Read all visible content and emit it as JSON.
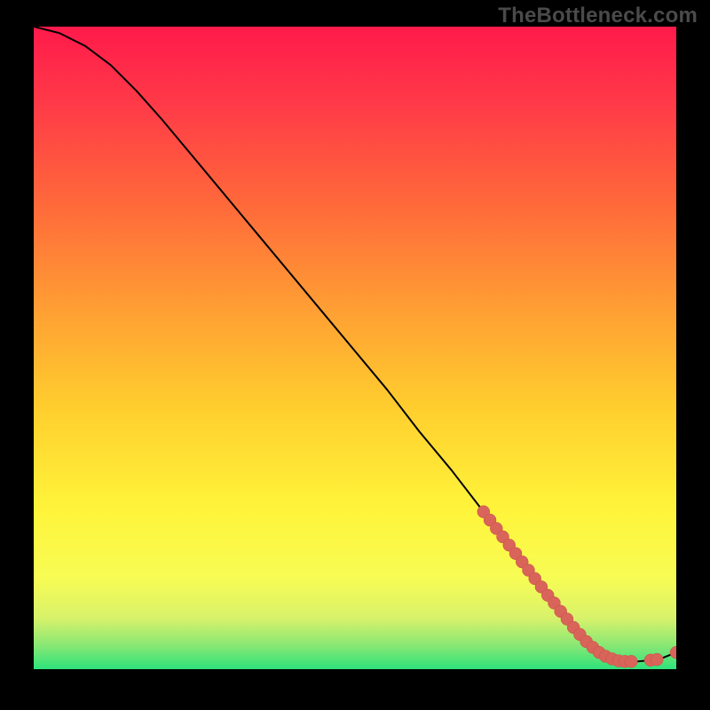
{
  "watermark": "TheBottleneck.com",
  "colors": {
    "gradient_top": "#ff1a4b",
    "gradient_mid_upper": "#ff6a3a",
    "gradient_mid": "#ffd02e",
    "gradient_mid_lower": "#fff43a",
    "gradient_lower": "#d8f26a",
    "gradient_bottom": "#2ee27b",
    "curve": "#000000",
    "marker_fill": "#d9645a",
    "marker_stroke": "#c94f45"
  },
  "chart_data": {
    "type": "line",
    "title": "",
    "xlabel": "",
    "ylabel": "",
    "xlim": [
      0,
      100
    ],
    "ylim": [
      0,
      100
    ],
    "curve": {
      "x": [
        0,
        4,
        8,
        12,
        16,
        20,
        25,
        30,
        35,
        40,
        45,
        50,
        55,
        60,
        65,
        70,
        75,
        80,
        82,
        84,
        86,
        88,
        90,
        92,
        94,
        96,
        98,
        100
      ],
      "y": [
        100,
        99,
        97,
        94,
        90,
        85.5,
        79.5,
        73.5,
        67.5,
        61.5,
        55.5,
        49.5,
        43.5,
        37,
        31,
        24.5,
        18,
        11.5,
        9,
        6.5,
        4.3,
        2.6,
        1.6,
        1.2,
        1.2,
        1.4,
        1.8,
        2.6
      ]
    },
    "series": [
      {
        "name": "data-points",
        "x": [
          70,
          71,
          72,
          73,
          74,
          75,
          76,
          77,
          78,
          79,
          80,
          81,
          82,
          83,
          84,
          85,
          86,
          87,
          88,
          89,
          90,
          91,
          92,
          93,
          96,
          97,
          100
        ],
        "y": [
          24.5,
          23.2,
          21.9,
          20.6,
          19.3,
          18.0,
          16.7,
          15.4,
          14.1,
          12.8,
          11.5,
          10.3,
          9.0,
          7.8,
          6.5,
          5.4,
          4.3,
          3.4,
          2.6,
          2.0,
          1.6,
          1.3,
          1.2,
          1.2,
          1.4,
          1.5,
          2.6
        ]
      }
    ]
  }
}
